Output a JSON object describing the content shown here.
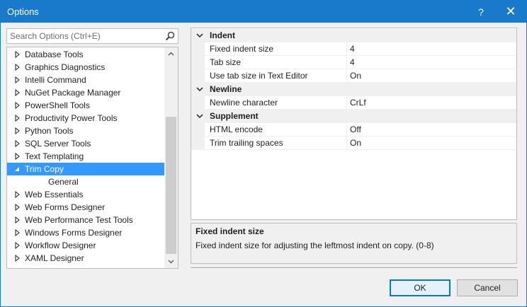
{
  "window": {
    "title": "Options",
    "help_glyph": "?",
    "close_glyph": "✕"
  },
  "search": {
    "placeholder": "Search Options (Ctrl+E)"
  },
  "tree": {
    "items": [
      {
        "label": "Database Tools",
        "expanded": false
      },
      {
        "label": "Graphics Diagnostics",
        "expanded": false
      },
      {
        "label": "Intelli Command",
        "expanded": false
      },
      {
        "label": "NuGet Package Manager",
        "expanded": false
      },
      {
        "label": "PowerShell Tools",
        "expanded": false
      },
      {
        "label": "Productivity Power Tools",
        "expanded": false
      },
      {
        "label": "Python Tools",
        "expanded": false
      },
      {
        "label": "SQL Server Tools",
        "expanded": false
      },
      {
        "label": "Text Templating",
        "expanded": false
      },
      {
        "label": "Trim Copy",
        "expanded": true,
        "selected": true
      },
      {
        "label": "General",
        "child": true
      },
      {
        "label": "Web Essentials",
        "expanded": false
      },
      {
        "label": "Web Forms Designer",
        "expanded": false
      },
      {
        "label": "Web Performance Test Tools",
        "expanded": false
      },
      {
        "label": "Windows Forms Designer",
        "expanded": false
      },
      {
        "label": "Workflow Designer",
        "expanded": false
      },
      {
        "label": "XAML Designer",
        "expanded": false
      }
    ]
  },
  "properties": {
    "categories": [
      {
        "name": "Indent",
        "rows": [
          {
            "name": "Fixed indent size",
            "value": "4"
          },
          {
            "name": "Tab size",
            "value": "4"
          },
          {
            "name": "Use tab size in Text Editor",
            "value": "On"
          }
        ]
      },
      {
        "name": "Newline",
        "rows": [
          {
            "name": "Newline character",
            "value": "CrLf"
          }
        ]
      },
      {
        "name": "Supplement",
        "rows": [
          {
            "name": "HTML encode",
            "value": "Off"
          },
          {
            "name": "Trim trailing spaces",
            "value": "On"
          }
        ]
      }
    ]
  },
  "description": {
    "title": "Fixed indent size",
    "text": "Fixed indent size for adjusting the leftmost indent on copy. (0-8)"
  },
  "buttons": {
    "ok": "OK",
    "cancel": "Cancel"
  },
  "colors": {
    "titlebar": "#1979ca",
    "selection": "#3399ff"
  }
}
